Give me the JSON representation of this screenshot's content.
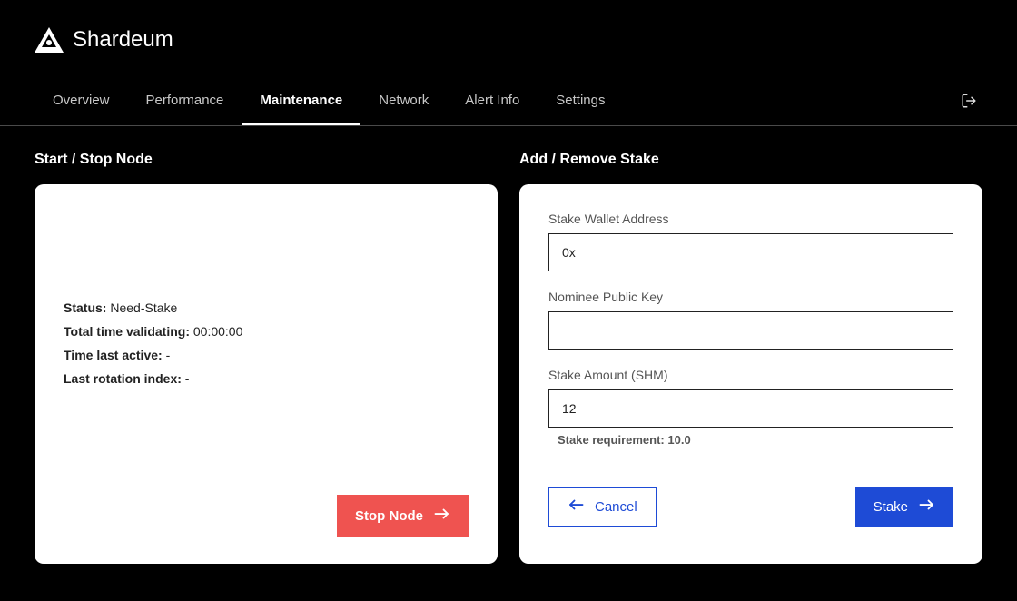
{
  "brand": {
    "name": "Shardeum"
  },
  "tabs": {
    "items": [
      "Overview",
      "Performance",
      "Maintenance",
      "Network",
      "Alert Info",
      "Settings"
    ],
    "active_index": 2
  },
  "left": {
    "title": "Start / Stop Node",
    "status_label": "Status:",
    "status_value": "Need-Stake",
    "total_time_label": "Total time validating:",
    "total_time_value": "00:00:00",
    "last_active_label": "Time last active:",
    "last_active_value": "-",
    "rotation_label": "Last rotation index:",
    "rotation_value": "-",
    "stop_button": "Stop Node"
  },
  "right": {
    "title": "Add / Remove Stake",
    "wallet_label": "Stake Wallet Address",
    "wallet_value": "0x",
    "nominee_label": "Nominee Public Key",
    "nominee_value": "",
    "amount_label": "Stake Amount (SHM)",
    "amount_value": "12",
    "requirement_label": "Stake requirement:",
    "requirement_value": "10.0",
    "cancel_button": "Cancel",
    "stake_button": "Stake"
  }
}
